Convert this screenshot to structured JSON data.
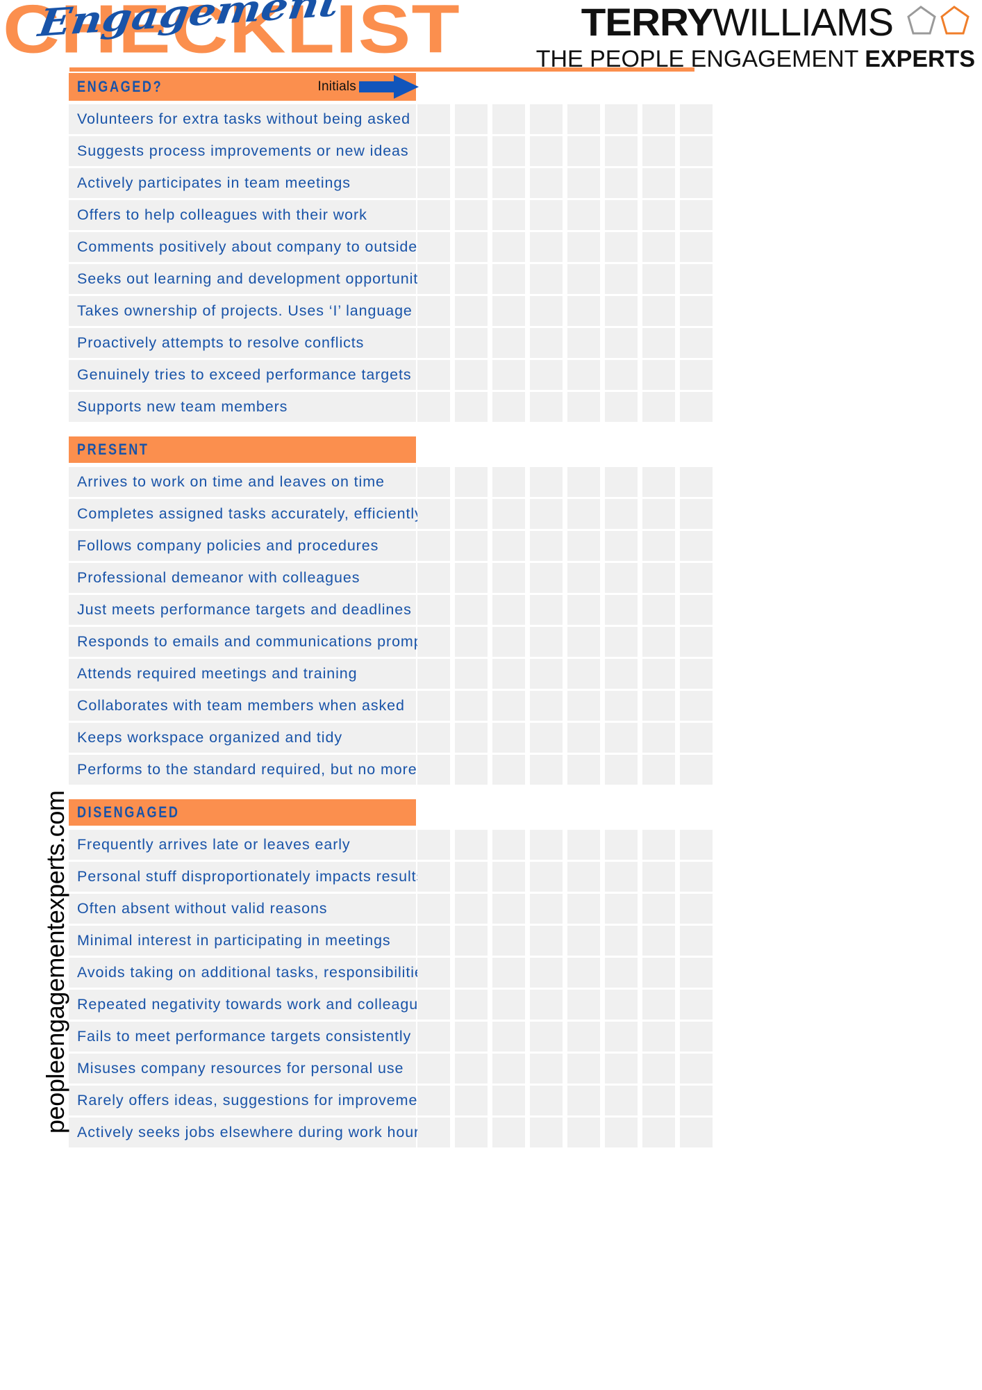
{
  "header": {
    "title_main": "CHECKLIST",
    "title_script": "Engagement",
    "logo": {
      "brand_bold": "TERRY",
      "brand_light": "WILLIAMS",
      "tagline_normal": "THE PEOPLE ENGAGEMENT ",
      "tagline_bold": "EXPERTS",
      "mark_name": "two-overlapping-pentagons",
      "mark_color_gray": "#9a9a9a",
      "mark_color_orange": "#f07e2a"
    }
  },
  "colors": {
    "accent_orange": "#fb8f4e",
    "accent_blue": "#1853a8",
    "row_gray": "#f0f0f0",
    "initials_box": "#f3e6f7",
    "arrow_blue": "#1155bb"
  },
  "grid": {
    "column_count": 8,
    "initials_label": "Initials",
    "arrow_icon": "arrow-right-icon"
  },
  "sections": [
    {
      "id": "engaged",
      "title": "ENGAGED?",
      "has_initials_header": true,
      "items": [
        "Volunteers for extra tasks without being asked",
        "Suggests process improvements or new ideas",
        "Actively participates in team meetings",
        "Offers to help colleagues with their work",
        "Comments positively about company to outsiders",
        "Seeks out learning and development opportunities",
        "Takes ownership of projects. Uses ‘I’ language",
        "Proactively attempts to resolve conflicts",
        "Genuinely tries to exceed performance targets",
        "Supports new team members"
      ]
    },
    {
      "id": "present",
      "title": "PRESENT",
      "has_initials_header": false,
      "items": [
        "Arrives to work on time and leaves on time",
        "Completes assigned tasks accurately, efficiently",
        "Follows company policies and procedures",
        "Professional demeanor with colleagues",
        "Just meets performance targets and deadlines",
        "Responds to emails and communications promptly",
        "Attends required meetings and training",
        "Collaborates with team members when asked",
        "Keeps workspace organized and tidy",
        "Performs to the standard required, but no more"
      ]
    },
    {
      "id": "disengaged",
      "title": "DISENGAGED",
      "has_initials_header": false,
      "items": [
        "Frequently arrives late or leaves early",
        "Personal stuff disproportionately impacts results",
        "Often absent without valid reasons",
        "Minimal interest in participating in meetings",
        "Avoids taking on additional tasks, responsibilities",
        "Repeated negativity towards work and colleagues",
        "Fails to meet performance targets consistently",
        "Misuses company resources for personal use",
        "Rarely offers ideas, suggestions for improvement",
        "Actively seeks jobs elsewhere during work hours"
      ]
    }
  ],
  "footer": {
    "website": "peopleengagementexperts.com"
  }
}
